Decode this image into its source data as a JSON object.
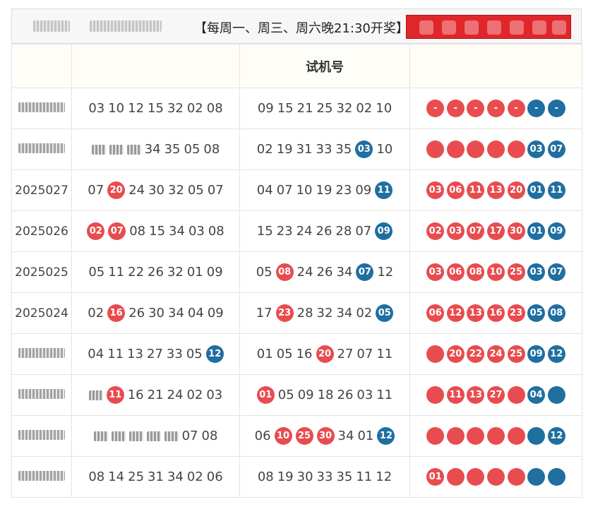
{
  "notice": "【每周一、周三、周六晚21:30开奖】",
  "table": {
    "header": [
      "",
      "",
      "试机号",
      ""
    ],
    "rows": [
      {
        "issue": "",
        "issue_blurred": true,
        "pick1": [
          {
            "t": "03"
          },
          {
            "t": "10"
          },
          {
            "t": "12"
          },
          {
            "t": "15"
          },
          {
            "t": "32"
          },
          {
            "t": "02"
          },
          {
            "t": "08"
          }
        ],
        "pick2": [
          {
            "t": "09"
          },
          {
            "t": "15"
          },
          {
            "t": "21"
          },
          {
            "t": "25"
          },
          {
            "t": "32"
          },
          {
            "t": "02"
          },
          {
            "t": "10"
          }
        ],
        "draw": [
          {
            "t": "-",
            "c": "red"
          },
          {
            "t": "-",
            "c": "red"
          },
          {
            "t": "-",
            "c": "red"
          },
          {
            "t": "-",
            "c": "red"
          },
          {
            "t": "-",
            "c": "red"
          },
          {
            "t": "-",
            "c": "blue"
          },
          {
            "t": "-",
            "c": "blue"
          }
        ]
      },
      {
        "issue": "",
        "issue_blurred": true,
        "pick1": [
          {
            "t": "",
            "s": "fuzz"
          },
          {
            "t": "",
            "s": "fuzz"
          },
          {
            "t": "",
            "s": "fuzz"
          },
          {
            "t": "34"
          },
          {
            "t": "35"
          },
          {
            "t": "05"
          },
          {
            "t": "08"
          }
        ],
        "pick2": [
          {
            "t": "02"
          },
          {
            "t": "19"
          },
          {
            "t": "31"
          },
          {
            "t": "33"
          },
          {
            "t": "35"
          },
          {
            "t": "03",
            "s": "blue"
          },
          {
            "t": "10"
          }
        ],
        "draw": [
          {
            "t": "",
            "c": "red"
          },
          {
            "t": "",
            "c": "red"
          },
          {
            "t": "",
            "c": "red"
          },
          {
            "t": "",
            "c": "red"
          },
          {
            "t": "",
            "c": "red"
          },
          {
            "t": "03",
            "c": "blue"
          },
          {
            "t": "07",
            "c": "blue"
          }
        ]
      },
      {
        "issue": "2025027",
        "pick1": [
          {
            "t": "07"
          },
          {
            "t": "20",
            "s": "red"
          },
          {
            "t": "24"
          },
          {
            "t": "30"
          },
          {
            "t": "32"
          },
          {
            "t": "05"
          },
          {
            "t": "07"
          }
        ],
        "pick2": [
          {
            "t": "04"
          },
          {
            "t": "07"
          },
          {
            "t": "10"
          },
          {
            "t": "19"
          },
          {
            "t": "23"
          },
          {
            "t": "09"
          },
          {
            "t": "11",
            "s": "blue"
          }
        ],
        "draw": [
          {
            "t": "03",
            "c": "red"
          },
          {
            "t": "06",
            "c": "red"
          },
          {
            "t": "11",
            "c": "red"
          },
          {
            "t": "13",
            "c": "red"
          },
          {
            "t": "20",
            "c": "red"
          },
          {
            "t": "01",
            "c": "blue"
          },
          {
            "t": "11",
            "c": "blue"
          }
        ]
      },
      {
        "issue": "2025026",
        "pick1": [
          {
            "t": "02",
            "s": "red"
          },
          {
            "t": "07",
            "s": "red"
          },
          {
            "t": "08"
          },
          {
            "t": "15"
          },
          {
            "t": "34"
          },
          {
            "t": "03"
          },
          {
            "t": "08"
          }
        ],
        "pick2": [
          {
            "t": "15"
          },
          {
            "t": "23"
          },
          {
            "t": "24"
          },
          {
            "t": "26"
          },
          {
            "t": "28"
          },
          {
            "t": "07"
          },
          {
            "t": "09",
            "s": "blue"
          }
        ],
        "draw": [
          {
            "t": "02",
            "c": "red"
          },
          {
            "t": "03",
            "c": "red"
          },
          {
            "t": "07",
            "c": "red"
          },
          {
            "t": "17",
            "c": "red"
          },
          {
            "t": "30",
            "c": "red"
          },
          {
            "t": "01",
            "c": "blue"
          },
          {
            "t": "09",
            "c": "blue"
          }
        ]
      },
      {
        "issue": "2025025",
        "pick1": [
          {
            "t": "05"
          },
          {
            "t": "11"
          },
          {
            "t": "22"
          },
          {
            "t": "26"
          },
          {
            "t": "32"
          },
          {
            "t": "01"
          },
          {
            "t": "09"
          }
        ],
        "pick2": [
          {
            "t": "05"
          },
          {
            "t": "08",
            "s": "red"
          },
          {
            "t": "24"
          },
          {
            "t": "26"
          },
          {
            "t": "34"
          },
          {
            "t": "07",
            "s": "blue"
          },
          {
            "t": "12"
          }
        ],
        "draw": [
          {
            "t": "03",
            "c": "red"
          },
          {
            "t": "06",
            "c": "red"
          },
          {
            "t": "08",
            "c": "red"
          },
          {
            "t": "10",
            "c": "red"
          },
          {
            "t": "25",
            "c": "red"
          },
          {
            "t": "03",
            "c": "blue"
          },
          {
            "t": "07",
            "c": "blue"
          }
        ]
      },
      {
        "issue": "2025024",
        "pick1": [
          {
            "t": "02"
          },
          {
            "t": "16",
            "s": "red"
          },
          {
            "t": "26"
          },
          {
            "t": "30"
          },
          {
            "t": "34"
          },
          {
            "t": "04"
          },
          {
            "t": "09"
          }
        ],
        "pick2": [
          {
            "t": "17"
          },
          {
            "t": "23",
            "s": "red"
          },
          {
            "t": "28"
          },
          {
            "t": "32"
          },
          {
            "t": "34"
          },
          {
            "t": "02"
          },
          {
            "t": "05",
            "s": "blue"
          }
        ],
        "draw": [
          {
            "t": "06",
            "c": "red"
          },
          {
            "t": "12",
            "c": "red"
          },
          {
            "t": "13",
            "c": "red"
          },
          {
            "t": "16",
            "c": "red"
          },
          {
            "t": "23",
            "c": "red"
          },
          {
            "t": "05",
            "c": "blue"
          },
          {
            "t": "08",
            "c": "blue"
          }
        ]
      },
      {
        "issue": "",
        "issue_blurred": true,
        "pick1": [
          {
            "t": "04"
          },
          {
            "t": "11"
          },
          {
            "t": "13"
          },
          {
            "t": "27"
          },
          {
            "t": "33"
          },
          {
            "t": "05"
          },
          {
            "t": "12",
            "s": "blue"
          }
        ],
        "pick2": [
          {
            "t": "01"
          },
          {
            "t": "05"
          },
          {
            "t": "16"
          },
          {
            "t": "20",
            "s": "red"
          },
          {
            "t": "27"
          },
          {
            "t": "07"
          },
          {
            "t": "11"
          }
        ],
        "draw": [
          {
            "t": "",
            "c": "red"
          },
          {
            "t": "20",
            "c": "red"
          },
          {
            "t": "22",
            "c": "red"
          },
          {
            "t": "24",
            "c": "red"
          },
          {
            "t": "25",
            "c": "red"
          },
          {
            "t": "09",
            "c": "blue"
          },
          {
            "t": "12",
            "c": "blue"
          }
        ]
      },
      {
        "issue": "",
        "issue_blurred": true,
        "pick1": [
          {
            "t": "",
            "s": "fuzz"
          },
          {
            "t": "11",
            "s": "red"
          },
          {
            "t": "16"
          },
          {
            "t": "21"
          },
          {
            "t": "24"
          },
          {
            "t": "02"
          },
          {
            "t": "03"
          }
        ],
        "pick2": [
          {
            "t": "01",
            "s": "red"
          },
          {
            "t": "05"
          },
          {
            "t": "09"
          },
          {
            "t": "18"
          },
          {
            "t": "26"
          },
          {
            "t": "03"
          },
          {
            "t": "11"
          }
        ],
        "draw": [
          {
            "t": "",
            "c": "red"
          },
          {
            "t": "11",
            "c": "red"
          },
          {
            "t": "13",
            "c": "red"
          },
          {
            "t": "27",
            "c": "red"
          },
          {
            "t": "",
            "c": "red"
          },
          {
            "t": "04",
            "c": "blue"
          },
          {
            "t": "",
            "c": "blue"
          }
        ]
      },
      {
        "issue": "",
        "issue_blurred": true,
        "pick1": [
          {
            "t": "",
            "s": "fuzz"
          },
          {
            "t": "",
            "s": "fuzz"
          },
          {
            "t": "",
            "s": "fuzz"
          },
          {
            "t": "",
            "s": "fuzz"
          },
          {
            "t": "",
            "s": "fuzz"
          },
          {
            "t": "07"
          },
          {
            "t": "08"
          }
        ],
        "pick2": [
          {
            "t": "06"
          },
          {
            "t": "10",
            "s": "red"
          },
          {
            "t": "25",
            "s": "red"
          },
          {
            "t": "30",
            "s": "red"
          },
          {
            "t": "34"
          },
          {
            "t": "01"
          },
          {
            "t": "12",
            "s": "blue"
          }
        ],
        "draw": [
          {
            "t": "",
            "c": "red"
          },
          {
            "t": "",
            "c": "red"
          },
          {
            "t": "",
            "c": "red"
          },
          {
            "t": "",
            "c": "red"
          },
          {
            "t": "",
            "c": "red"
          },
          {
            "t": "",
            "c": "blue"
          },
          {
            "t": "12",
            "c": "blue"
          }
        ]
      },
      {
        "issue": "",
        "issue_blurred": true,
        "pick1": [
          {
            "t": "08"
          },
          {
            "t": "14"
          },
          {
            "t": "25"
          },
          {
            "t": "31"
          },
          {
            "t": "34"
          },
          {
            "t": "02"
          },
          {
            "t": "06"
          }
        ],
        "pick2": [
          {
            "t": "08"
          },
          {
            "t": "19"
          },
          {
            "t": "30"
          },
          {
            "t": "33"
          },
          {
            "t": "35"
          },
          {
            "t": "11"
          },
          {
            "t": "12"
          }
        ],
        "draw": [
          {
            "t": "01",
            "c": "red"
          },
          {
            "t": "",
            "c": "red"
          },
          {
            "t": "",
            "c": "red"
          },
          {
            "t": "",
            "c": "red"
          },
          {
            "t": "",
            "c": "red"
          },
          {
            "t": "",
            "c": "blue"
          },
          {
            "t": "",
            "c": "blue"
          }
        ]
      }
    ]
  },
  "colors": {
    "red_ball": "#e84c4f",
    "blue_ball": "#1f6fa0",
    "banner": "#e0262a"
  }
}
